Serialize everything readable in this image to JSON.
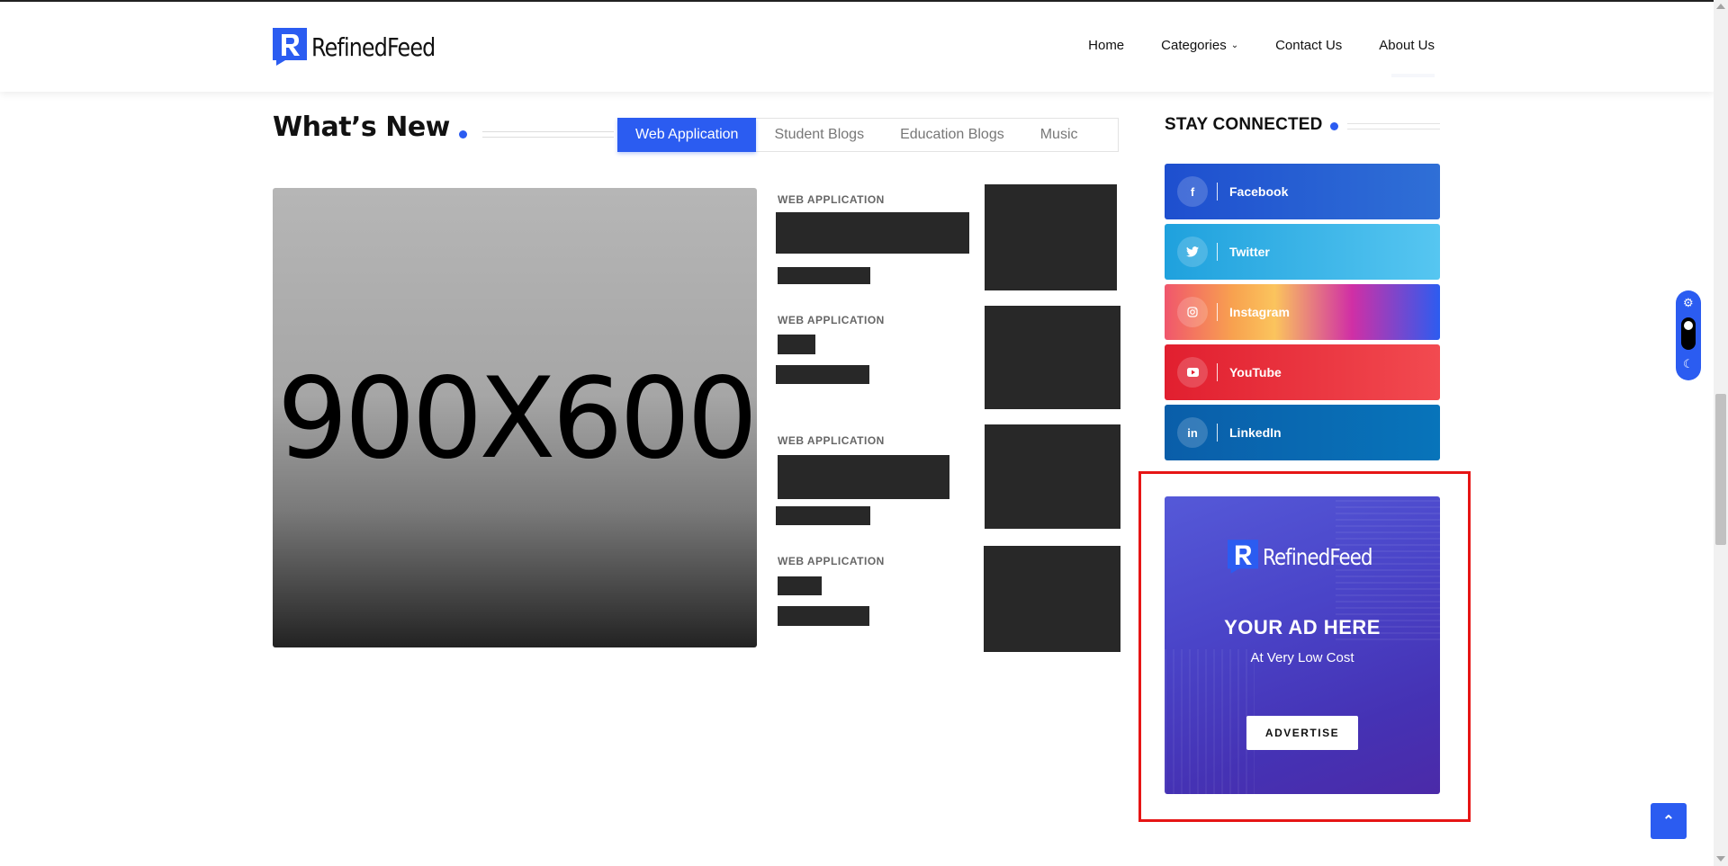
{
  "brand": {
    "name": "RefinedFeed",
    "accent": "#2b5cf1"
  },
  "nav": {
    "items": [
      {
        "label": "Home"
      },
      {
        "label": "Categories",
        "has_dropdown": true
      },
      {
        "label": "Contact Us"
      },
      {
        "label": "About Us"
      }
    ]
  },
  "section": {
    "title": "What’s New",
    "tabs": [
      {
        "label": "Web Application",
        "active": true
      },
      {
        "label": "Student Blogs",
        "active": false
      },
      {
        "label": "Education Blogs",
        "active": false
      },
      {
        "label": "Music",
        "active": false
      }
    ]
  },
  "feature": {
    "placeholder": "900X600"
  },
  "posts": [
    {
      "category": "WEB APPLICATION"
    },
    {
      "category": "WEB APPLICATION"
    },
    {
      "category": "WEB APPLICATION"
    },
    {
      "category": "WEB APPLICATION"
    }
  ],
  "sidebar": {
    "title": "STAY CONNECTED",
    "social": [
      {
        "name": "Facebook",
        "icon": "facebook-icon",
        "glyph": "f"
      },
      {
        "name": "Twitter",
        "icon": "twitter-icon",
        "glyph": "🐦"
      },
      {
        "name": "Instagram",
        "icon": "instagram-icon",
        "glyph": "◎"
      },
      {
        "name": "YouTube",
        "icon": "youtube-icon",
        "glyph": "▶"
      },
      {
        "name": "LinkedIn",
        "icon": "linkedin-icon",
        "glyph": "in"
      }
    ],
    "ad": {
      "brand": "RefinedFeed",
      "headline": "YOUR AD HERE",
      "subline": "At Very Low Cost",
      "button_label": "ADVERTISE",
      "highlight_color": "#e61515"
    }
  },
  "icons": {
    "theme_light": "sun-icon",
    "theme_dark": "moon-icon",
    "back_to_top": "double-chevron-up-icon",
    "dropdown": "chevron-down-icon"
  }
}
